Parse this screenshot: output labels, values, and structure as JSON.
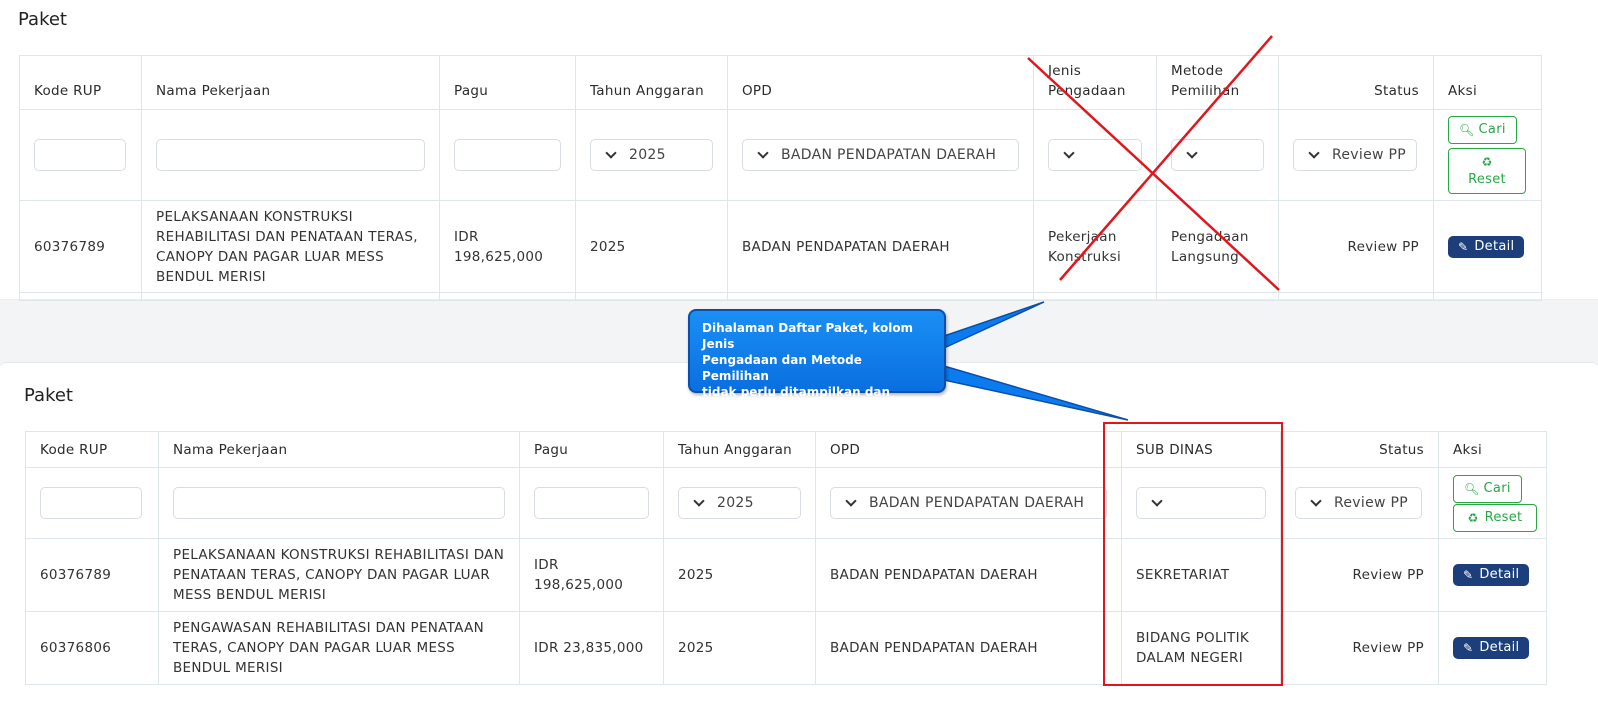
{
  "top_panel": {
    "title": "Paket",
    "headers": [
      "Kode RUP",
      "Nama Pekerjaan",
      "Pagu",
      "Tahun Anggaran",
      "OPD",
      "Jenis Pengadaan",
      "Metode Pemilihan",
      "Status",
      "Aksi"
    ],
    "filters": {
      "tahun": "2025",
      "opd": "BADAN PENDAPATAN DAERAH",
      "jenis": "",
      "metode": "",
      "status": "Review PP",
      "cari_label": "Cari",
      "reset_label": "Reset"
    },
    "row": {
      "kode": "60376789",
      "nama": "PELAKSANAAN KONSTRUKSI REHABILITASI DAN PENATAAN TERAS, CANOPY DAN PAGAR LUAR MESS BENDUL MERISI",
      "pagu": "IDR 198,625,000",
      "tahun": "2025",
      "opd": "BADAN PENDAPATAN DAERAH",
      "jenis": "Pekerjaan Konstruksi",
      "metode": "Pengadaan Langsung",
      "status": "Review PP",
      "detail_label": "Detail"
    }
  },
  "callout": {
    "text": "Dihalaman Daftar Paket, kolom Jenis\nPengadaan dan Metode Pemilihan\n tidak perlu ditampilkan dan diganti\n Sub Dinas"
  },
  "bottom_panel": {
    "title": "Paket",
    "headers": [
      "Kode RUP",
      "Nama Pekerjaan",
      "Pagu",
      "Tahun Anggaran",
      "OPD",
      "SUB DINAS",
      "Status",
      "Aksi"
    ],
    "filters": {
      "tahun": "2025",
      "opd": "BADAN PENDAPATAN DAERAH",
      "subdinas": "",
      "status": "Review PP",
      "cari_label": "Cari",
      "reset_label": "Reset"
    },
    "rows": [
      {
        "kode": "60376789",
        "nama": "PELAKSANAAN KONSTRUKSI REHABILITASI DAN PENATAAN TERAS, CANOPY DAN PAGAR LUAR MESS BENDUL MERISI",
        "pagu": "IDR 198,625,000",
        "tahun": "2025",
        "opd": "BADAN PENDAPATAN DAERAH",
        "subdinas": "SEKRETARIAT",
        "status": "Review PP",
        "detail_label": "Detail"
      },
      {
        "kode": "60376806",
        "nama": "PENGAWASAN REHABILITASI DAN PENATAAN TERAS, CANOPY DAN PAGAR LUAR MESS BENDUL MERISI",
        "pagu": "IDR 23,835,000",
        "tahun": "2025",
        "opd": "BADAN PENDAPATAN DAERAH",
        "subdinas": "BIDANG POLITIK DALAM NEGERI",
        "status": "Review PP",
        "detail_label": "Detail"
      }
    ]
  },
  "colors": {
    "accent_green": "#28a745",
    "detail_blue": "#1c3e7a",
    "callout_blue": "#0a7cf0",
    "annotation_red": "#e0161d"
  },
  "icons": {
    "search": "search-icon",
    "recycle": "recycle-icon",
    "edit": "edit-icon",
    "chevron": "chevron-down-icon"
  }
}
